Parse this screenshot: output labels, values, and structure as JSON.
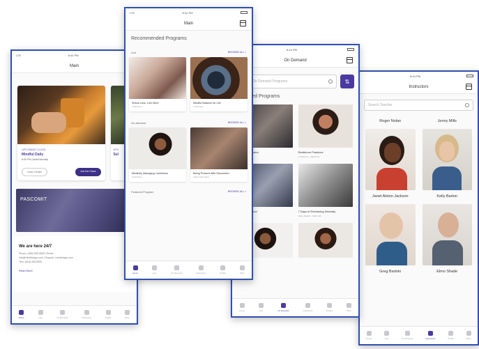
{
  "screen1": {
    "status": {
      "left": "LTE",
      "time": "8:44 PM"
    },
    "title": "Main",
    "class": {
      "eyebrow": "UPCOMING CLASS",
      "name": "Mindful Daily",
      "time": "8:00 PM  (Asia/Calcutta)",
      "details_button": "Class Details",
      "join_button": "Join the Class"
    },
    "class2": {
      "eyebrow": "UPC",
      "name": "Sel"
    },
    "banner": "PASCOMIT",
    "contact": {
      "heading": "We are here 24/7",
      "line1": "Phone: (555) 555-5555  |  Email:",
      "line2": "info@mindfulapp.com  |  Support: mindfulapp.com",
      "line3": "Text: (618) 555-5555",
      "read_more": "Read More"
    },
    "tabs": [
      "Home",
      "Live",
      "On Demand",
      "Instructors",
      "Profile",
      "More"
    ]
  },
  "screen2": {
    "status": {
      "left": "LTE",
      "time": "8:44 PM"
    },
    "title": "Main",
    "heading": "Recommended Programs",
    "live": {
      "label": "Live",
      "browse": "BROWSE ALL >",
      "cards": [
        {
          "title": "Stress Less, Live More",
          "sub": "4 Sessions"
        },
        {
          "title": "Mindful Balance for Life",
          "sub": "4 Sessions"
        }
      ]
    },
    "ondemand": {
      "label": "On-demand",
      "browse": "BROWSE ALL >",
      "cards": [
        {
          "title": "Mindfully Managing Loneliness",
          "sub": "4 Sessions"
        },
        {
          "title": "Being Present With Discomfort",
          "sub": "Class Information"
        }
      ]
    },
    "featured": {
      "label": "Featured Program",
      "browse": "BROWSE ALL >"
    },
    "tabs": [
      "Home",
      "Live",
      "On Demand",
      "Instructors",
      "Profile",
      "More"
    ]
  },
  "screen3": {
    "status": {
      "left": "",
      "time": "8:44 PM"
    },
    "title": "On Demand",
    "search_placeholder": "Search On Demand Programs",
    "heading": "Featured Programs",
    "cards": [
      {
        "title": "Mindful Inclusion",
        "sub": "4 Sessions"
      },
      {
        "title": "Resilience Practices",
        "sub": "4 Sessions · Class Info"
      },
      {
        "title": "Communication",
        "sub": "4 Sessions"
      },
      {
        "title": "7 Days of Embracing Diversity",
        "sub": "Class Details · Class Info"
      }
    ],
    "tabs": [
      "Home",
      "Live",
      "On Demand",
      "Instructors",
      "Profile",
      "More"
    ]
  },
  "screen4": {
    "status": {
      "left": "",
      "time": "8:44 PM"
    },
    "title": "Instructors",
    "search_placeholder": "Search Teacher",
    "names": [
      "Roger Nolan",
      "Jenny Mills",
      "Janet Alston Jackson",
      "Kelly Barton",
      "Greg Bartolo",
      "Elmo Shade"
    ],
    "tabs": [
      "Home",
      "Live",
      "On Demand",
      "Instructors",
      "Profile",
      "More"
    ]
  },
  "colors": {
    "brand": "#4a3aa0",
    "frame": "#2f4fb0",
    "accent": "#5b52c4"
  }
}
